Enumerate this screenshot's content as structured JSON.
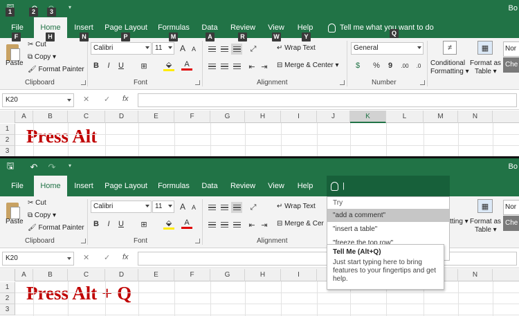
{
  "title": "Bo",
  "tabs": [
    "File",
    "Home",
    "Insert",
    "Page Layout",
    "Formulas",
    "Data",
    "Review",
    "View",
    "Help"
  ],
  "active_tab": "Home",
  "tell_me": {
    "placeholder": "Tell me what you want to do",
    "cursor": "|"
  },
  "keytips": {
    "qat_save": "1",
    "qat_undo": "2",
    "qat_redo": "3",
    "file": "F",
    "home": "H",
    "insert": "N",
    "page_layout": "P",
    "formulas": "M",
    "data": "A",
    "review": "R",
    "view": "W",
    "help": "Y",
    "tell_me": "Q"
  },
  "ribbon": {
    "clipboard": {
      "paste": "Paste",
      "cut": "Cut",
      "copy": "Copy",
      "format_painter": "Format Painter",
      "group": "Clipboard"
    },
    "font": {
      "name": "Calibri",
      "size": "11",
      "grow": "A",
      "shrink": "A",
      "bold": "B",
      "italic": "I",
      "underline": "U",
      "fill_letter": "",
      "font_color_letter": "A",
      "group": "Font"
    },
    "alignment": {
      "wrap_text": "Wrap Text",
      "merge_center": "Merge & Center",
      "merge_center_cut": "Merge & Cer",
      "group": "Alignment"
    },
    "number": {
      "format": "General",
      "currency": "$",
      "percent": "%",
      "comma": "9",
      "inc_decimal": ".00",
      "dec_decimal": ".0",
      "group": "Number"
    },
    "styles": {
      "conditional": "Conditional",
      "formatting": "Formatting",
      "formatting_cut": "tting",
      "format_as": "Format as",
      "table": "Table",
      "style_normal": "Nor",
      "style_check": "Che"
    }
  },
  "formula_bar": {
    "name_box": "K20",
    "cancel": "✕",
    "enter": "✓",
    "fx": "fx"
  },
  "columns": [
    "A",
    "B",
    "C",
    "D",
    "E",
    "F",
    "G",
    "H",
    "I",
    "J",
    "K",
    "L",
    "M",
    "N"
  ],
  "selected_column": "K",
  "rows": [
    "1",
    "2",
    "3"
  ],
  "captions": {
    "panel1": "Press Alt",
    "panel2": "Press Alt + Q"
  },
  "tell_me_dropdown": {
    "try": "Try",
    "items": [
      "\"add a comment\"",
      "\"insert a table\"",
      "\"freeze the top row\""
    ],
    "tip_title": "Tell Me (Alt+Q)",
    "tip_body": "Just start typing here to bring features to your fingertips and get help."
  },
  "colors": {
    "accent": "#217346",
    "caption_red": "#c00000",
    "keytip_bg": "#3a3a3a"
  }
}
